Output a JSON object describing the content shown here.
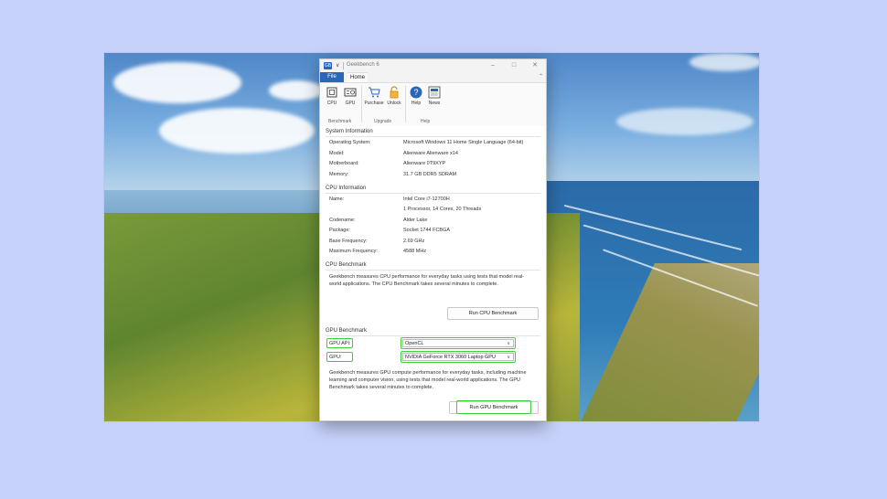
{
  "window": {
    "title": "Geekbench 6",
    "app_icon_text": "GB",
    "quick_access_arrow": "∨",
    "controls": {
      "minimize": "–",
      "maximize": "□",
      "close": "✕"
    }
  },
  "ribbon": {
    "tabs": [
      {
        "label": "File"
      },
      {
        "label": "Home"
      }
    ],
    "collapse_glyph": "⌃",
    "groups": [
      {
        "label": "Benchmark"
      },
      {
        "label": "Upgrade"
      },
      {
        "label": "Help"
      }
    ],
    "buttons": [
      {
        "label": "CPU",
        "icon": "cpu-icon"
      },
      {
        "label": "GPU",
        "icon": "gpu-icon"
      },
      {
        "label": "Purchase",
        "icon": "cart-icon"
      },
      {
        "label": "Unlock",
        "icon": "unlock-icon"
      },
      {
        "label": "Help",
        "icon": "help-icon"
      },
      {
        "label": "News",
        "icon": "news-icon"
      }
    ]
  },
  "system_info": {
    "title": "System Information",
    "rows": [
      {
        "label": "Operating System:",
        "value": "Microsoft Windows 11 Home Single Language (64-bit)"
      },
      {
        "label": "Model:",
        "value": "Alienware Alienware x14"
      },
      {
        "label": "Motherboard:",
        "value": "Alienware 0T9XYP"
      },
      {
        "label": "Memory:",
        "value": "31.7 GB DDR5 SDRAM"
      }
    ]
  },
  "cpu_info": {
    "title": "CPU Information",
    "rows": [
      {
        "label": "Name:",
        "value": "Intel Core i7-12700H"
      },
      {
        "label": "",
        "value": "1 Processor, 14 Cores, 20 Threads"
      },
      {
        "label": "Codename:",
        "value": "Alder Lake"
      },
      {
        "label": "Package:",
        "value": "Socket 1744 FCBGA"
      },
      {
        "label": "Base Frequency:",
        "value": "2.69 GHz"
      },
      {
        "label": "Maximum Frequency:",
        "value": "4588 MHz"
      }
    ]
  },
  "cpu_benchmark": {
    "title": "CPU Benchmark",
    "description": "Geekbench measures CPU performance for everyday tasks using tests that model real-world applications. The CPU Benchmark takes several minutes to complete.",
    "button_label": "Run CPU Benchmark"
  },
  "gpu_benchmark": {
    "title": "GPU Benchmark",
    "api_label": "GPU API:",
    "api_value": "OpenCL",
    "gpu_label": "GPU:",
    "gpu_value": "NVIDIA GeForce RTX 3060 Laptop GPU",
    "chevron": "∨",
    "description": "Geekbench measures GPU compute performance for everyday tasks, including machine learning and computer vision, using tests that model real-world applications. The GPU Benchmark takes several minutes to complete.",
    "button_label": "Run GPU Benchmark"
  },
  "colors": {
    "accent": "#2a67b8",
    "highlight": "#3bd13b",
    "background": "#c7d2fb"
  }
}
